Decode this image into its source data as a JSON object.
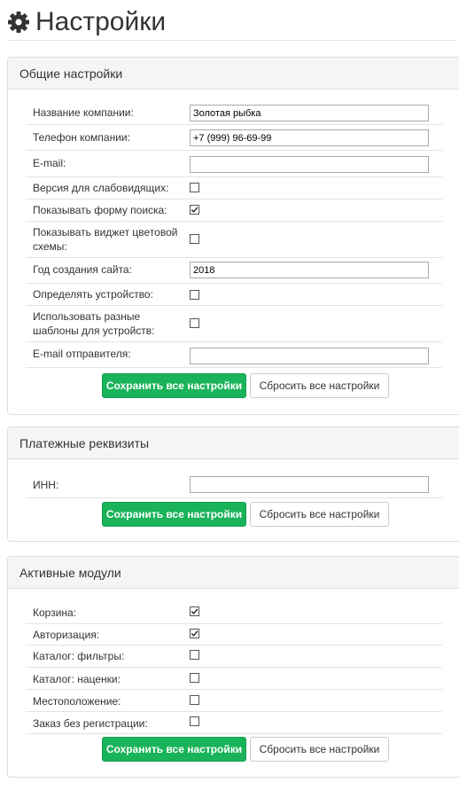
{
  "page": {
    "title": "Настройки"
  },
  "general": {
    "heading": "Общие настройки",
    "company_name": {
      "label": "Название компании:",
      "value": "Золотая рыбка"
    },
    "company_phone": {
      "label": "Телефон компании:",
      "value": "+7 (999) 96-69-99"
    },
    "email": {
      "label": "E-mail:",
      "value": ""
    },
    "low_vision": {
      "label": "Версия для слабовидящих:",
      "checked": false
    },
    "search_form": {
      "label": "Показывать форму поиска:",
      "checked": true
    },
    "color_widget": {
      "label": "Показывать виджет цветовой схемы:",
      "checked": false
    },
    "site_year": {
      "label": "Год создания сайта:",
      "value": "2018"
    },
    "detect_device": {
      "label": "Определять устройство:",
      "checked": false
    },
    "device_templates": {
      "label": "Использовать разные шаблоны для устройств:",
      "checked": false
    },
    "sender_email": {
      "label": "E-mail отправителя:",
      "value": ""
    },
    "save_label": "Сохранить все настройки",
    "reset_label": "Сбросить все настройки"
  },
  "payment": {
    "heading": "Платежные реквизиты",
    "inn": {
      "label": "ИНН:",
      "value": ""
    },
    "save_label": "Сохранить все настройки",
    "reset_label": "Сбросить все настройки"
  },
  "modules": {
    "heading": "Активные модули",
    "cart": {
      "label": "Корзина:",
      "checked": true
    },
    "auth": {
      "label": "Авторизация:",
      "checked": true
    },
    "catalog_filters": {
      "label": "Каталог: фильтры:",
      "checked": false
    },
    "catalog_markups": {
      "label": "Каталог: наценки:",
      "checked": false
    },
    "location": {
      "label": "Местоположение:",
      "checked": false
    },
    "guest_order": {
      "label": "Заказ без регистрации:",
      "checked": false
    },
    "save_label": "Сохранить все настройки",
    "reset_label": "Сбросить все настройки"
  }
}
